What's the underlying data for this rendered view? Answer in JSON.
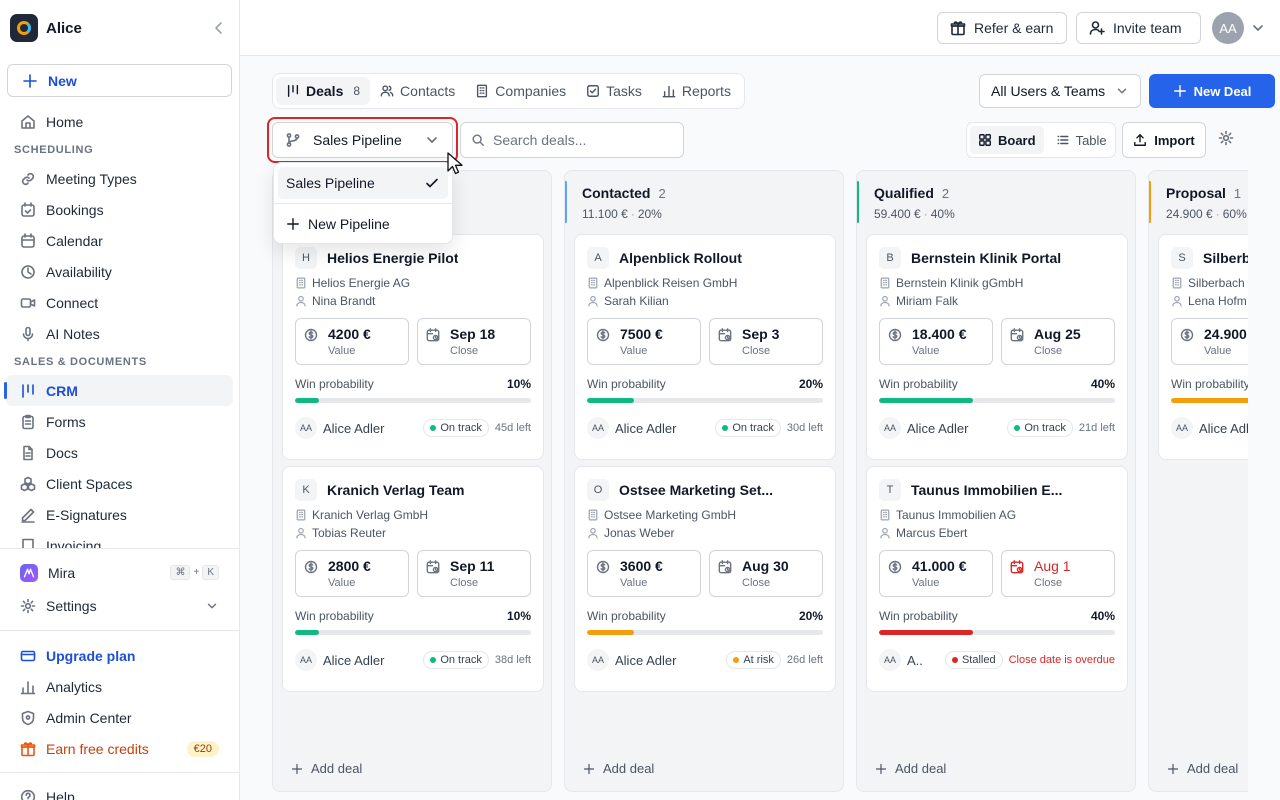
{
  "workspace": {
    "name": "Alice"
  },
  "sidebar": {
    "new_label": "New",
    "home": "Home",
    "section_scheduling": "SCHEDULING",
    "scheduling": [
      "Meeting Types",
      "Bookings",
      "Calendar",
      "Availability",
      "Connect",
      "AI Notes"
    ],
    "section_sales": "SALES & DOCUMENTS",
    "sales": [
      "CRM",
      "Forms",
      "Docs",
      "Client Spaces",
      "E-Signatures",
      "Invoicing"
    ],
    "mira": "Mira",
    "mira_keys": [
      "⌘",
      "+",
      "K"
    ],
    "settings": "Settings",
    "upgrade": "Upgrade plan",
    "analytics": "Analytics",
    "admin": "Admin Center",
    "earn": "Earn free credits",
    "earn_badge": "€20",
    "help": "Help"
  },
  "topbar": {
    "refer": "Refer & earn",
    "invite": "Invite team",
    "avatar": "AA"
  },
  "tabs": [
    {
      "label": "Deals",
      "count": "8"
    },
    {
      "label": "Contacts"
    },
    {
      "label": "Companies"
    },
    {
      "label": "Tasks"
    },
    {
      "label": "Reports"
    }
  ],
  "users_filter": "All Users & Teams",
  "new_deal": "New Deal",
  "pipeline": {
    "selected": "Sales Pipeline",
    "options": [
      "Sales Pipeline"
    ],
    "new_pipeline": "New Pipeline"
  },
  "search": {
    "placeholder": "Search deals..."
  },
  "view": {
    "board": "Board",
    "table": "Table"
  },
  "import": "Import",
  "add_deal": "Add deal",
  "win_label": "Win probability",
  "value_label": "Value",
  "close_label": "Close",
  "colors": {
    "accent": "#2563eb",
    "green": "#10b981",
    "orange": "#f59e0b",
    "red": "#dc2626"
  },
  "columns": [
    {
      "title": "",
      "count": "",
      "sum": "",
      "pct": "",
      "color": "",
      "cards": [
        {
          "ini": "H",
          "title": "Helios Energie Pilot",
          "company": "Helios Energie AG",
          "person": "Nina Brandt",
          "value": "4200 €",
          "close": "Sep 18",
          "prob": "10%",
          "prob_num": 0.1,
          "bar": "#10b981",
          "owner": "Alice Adler",
          "status": "On track",
          "dot": "#10b981",
          "left": "45d left"
        },
        {
          "ini": "K",
          "title": "Kranich Verlag Team",
          "company": "Kranich Verlag GmbH",
          "person": "Tobias Reuter",
          "value": "2800 €",
          "close": "Sep 11",
          "prob": "10%",
          "prob_num": 0.1,
          "bar": "#10b981",
          "owner": "Alice Adler",
          "status": "On track",
          "dot": "#10b981",
          "left": "38d left"
        }
      ]
    },
    {
      "title": "Contacted",
      "count": "2",
      "sum": "11.100 €",
      "pct": "20%",
      "color": "#60a5fa",
      "cards": [
        {
          "ini": "A",
          "title": "Alpenblick Rollout",
          "company": "Alpenblick Reisen GmbH",
          "person": "Sarah Kilian",
          "value": "7500 €",
          "close": "Sep 3",
          "prob": "20%",
          "prob_num": 0.2,
          "bar": "#10b981",
          "owner": "Alice Adler",
          "status": "On track",
          "dot": "#10b981",
          "left": "30d left"
        },
        {
          "ini": "O",
          "title": "Ostsee Marketing Set...",
          "company": "Ostsee Marketing GmbH",
          "person": "Jonas Weber",
          "value": "3600 €",
          "close": "Aug 30",
          "prob": "20%",
          "prob_num": 0.2,
          "bar": "#f59e0b",
          "owner": "Alice Adler",
          "status": "At risk",
          "dot": "#f59e0b",
          "left": "26d left"
        }
      ]
    },
    {
      "title": "Qualified",
      "count": "2",
      "sum": "59.400 €",
      "pct": "40%",
      "color": "#10b981",
      "cards": [
        {
          "ini": "B",
          "title": "Bernstein Klinik Portal",
          "company": "Bernstein Klinik gGmbH",
          "person": "Miriam Falk",
          "value": "18.400 €",
          "close": "Aug 25",
          "prob": "40%",
          "prob_num": 0.4,
          "bar": "#10b981",
          "owner": "Alice Adler",
          "status": "On track",
          "dot": "#10b981",
          "left": "21d left"
        },
        {
          "ini": "T",
          "title": "Taunus Immobilien E...",
          "company": "Taunus Immobilien AG",
          "person": "Marcus Ebert",
          "value": "41.000 €",
          "close": "Aug 1",
          "overdue": true,
          "prob": "40%",
          "prob_num": 0.4,
          "bar": "#dc2626",
          "owner": "A..",
          "status": "Stalled",
          "dot": "#dc2626",
          "left": "Close date is overdue"
        }
      ]
    },
    {
      "title": "Proposal",
      "count": "1",
      "sum": "24.900 €",
      "pct": "60%",
      "color": "#f59e0b",
      "cards": [
        {
          "ini": "S",
          "title": "Silberbach",
          "company": "Silberbach",
          "person": "Lena Hofm",
          "value": "24.900",
          "close": "",
          "prob": "",
          "prob_num": 0.6,
          "bar": "#f59e0b",
          "owner": "Alice Adl",
          "status": "",
          "dot": "",
          "left": ""
        }
      ]
    }
  ]
}
